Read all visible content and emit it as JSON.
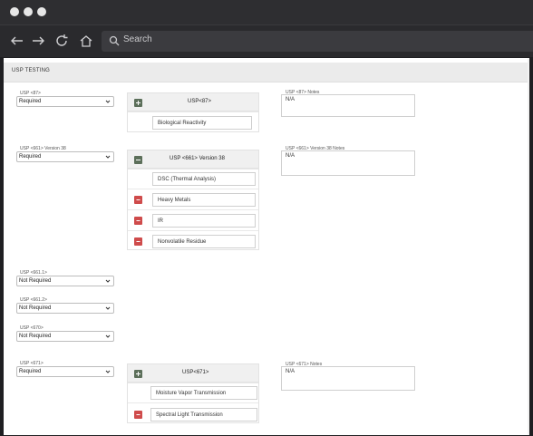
{
  "browser": {
    "search_placeholder": "Search",
    "window_controls": [
      "window-dot",
      "window-dot",
      "window-dot"
    ]
  },
  "section": {
    "title": "USP TESTING"
  },
  "fields": [
    {
      "label": "USP <87>",
      "value": "Required"
    },
    {
      "label": "USP <661> Version 38",
      "value": "Required"
    },
    {
      "label": "USP <661.1>",
      "value": "Not Required"
    },
    {
      "label": "USP <661.2>",
      "value": "Not Required"
    },
    {
      "label": "USP <670>",
      "value": "Not Required"
    },
    {
      "label": "USP <671>",
      "value": "Required"
    }
  ],
  "panels": [
    {
      "title": "USP<87>",
      "rows": [
        "Biological Reactivity"
      ]
    },
    {
      "title": "USP <661> Version 38",
      "rows": [
        "DSC (Thermal Analysis)",
        "Heavy Metals",
        "IR",
        "Nonvolatile Residue"
      ]
    },
    {
      "title": "USP<671>",
      "rows": [
        "Moisture Vapor Transmission",
        "Spectral Light Transmission"
      ]
    }
  ],
  "notes": [
    {
      "label": "USP <87> Notes",
      "value": "N/A"
    },
    {
      "label": "USP <661> Version 38 Notes",
      "value": "N/A"
    },
    {
      "label": "USP <671> Notes",
      "value": "N/A"
    }
  ]
}
